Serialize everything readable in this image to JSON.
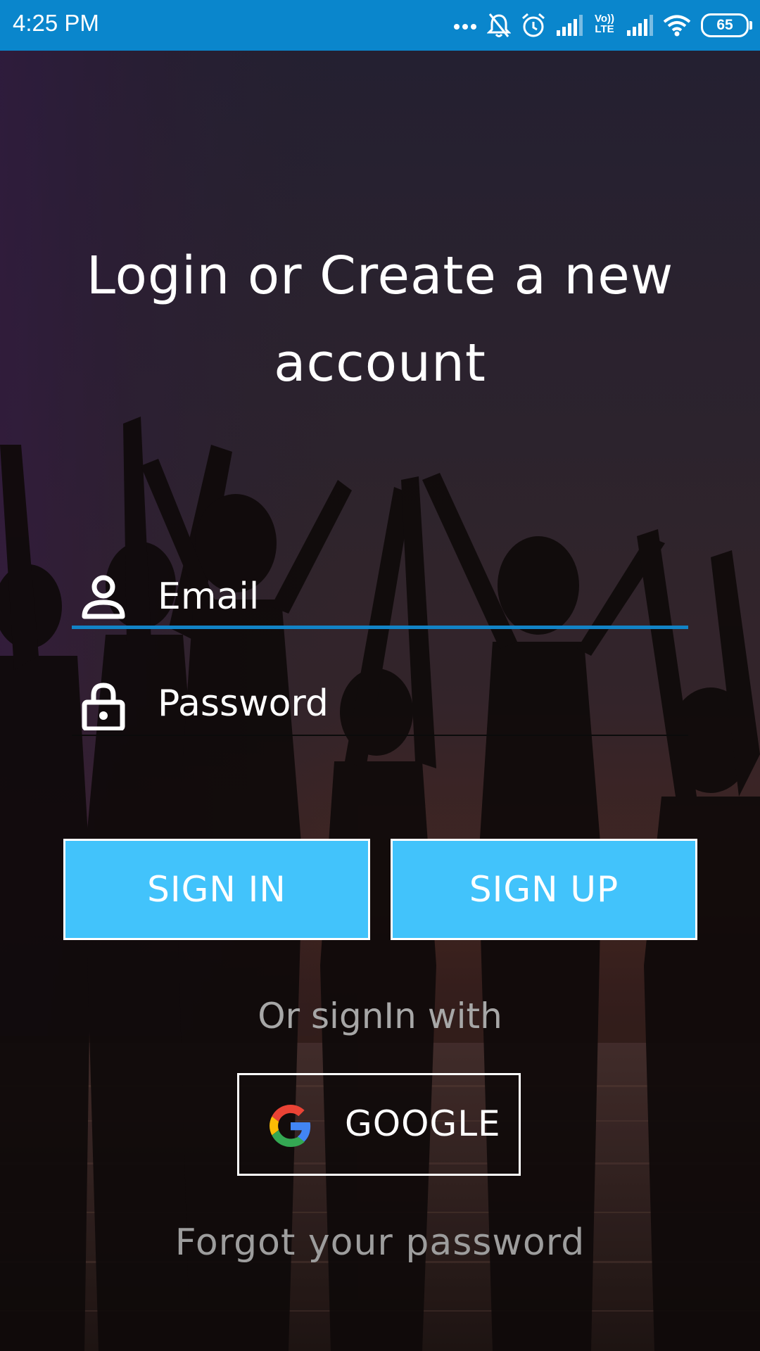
{
  "status_bar": {
    "time": "4:25 PM",
    "battery": "65",
    "icons": [
      "more-dots-icon",
      "notifications-off-icon",
      "alarm-icon",
      "signal-icon",
      "volte-icon",
      "signal-icon",
      "wifi-icon",
      "battery-icon"
    ],
    "volte_label_top": "Vo))",
    "volte_label_bottom": "LTE",
    "color": "#0a86cc"
  },
  "heading": {
    "line1": "Login or Create a new",
    "line2": "account"
  },
  "form": {
    "email_placeholder": "Email",
    "password_placeholder": "Password",
    "email_icon": "person-icon",
    "password_icon": "lock-icon",
    "active_underline_color": "#1283c6"
  },
  "buttons": {
    "sign_in": "SIGN IN",
    "sign_up": "SIGN UP",
    "color": "#42c3fb"
  },
  "alt_login": {
    "prompt": "Or signIn with",
    "google_label": "GOOGLE",
    "google_icon": "google-logo-icon"
  },
  "forgot_password": "Forgot your password"
}
